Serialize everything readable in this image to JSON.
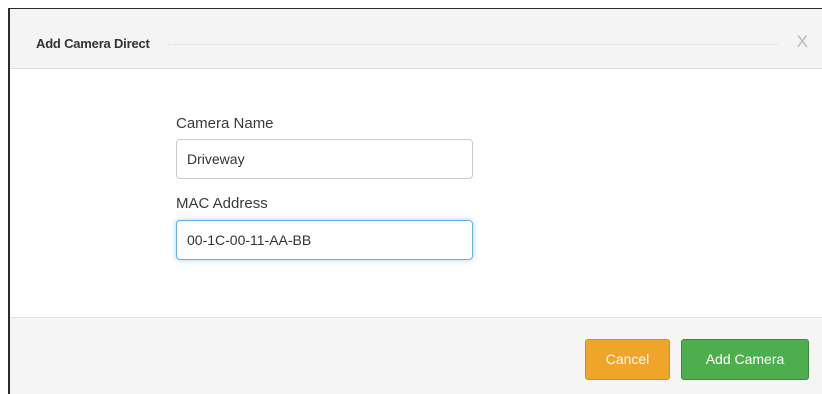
{
  "dialog": {
    "title": "Add Camera Direct",
    "close_label": "X"
  },
  "form": {
    "camera_name": {
      "label": "Camera Name",
      "value": "Driveway"
    },
    "mac_address": {
      "label": "MAC Address",
      "value": "00-1C-00-11-AA-BB"
    }
  },
  "footer": {
    "cancel_label": "Cancel",
    "add_label": "Add Camera"
  },
  "colors": {
    "cancel_button": "#f1a42a",
    "add_button": "#4cae4c",
    "focus_border": "#66afe9"
  }
}
